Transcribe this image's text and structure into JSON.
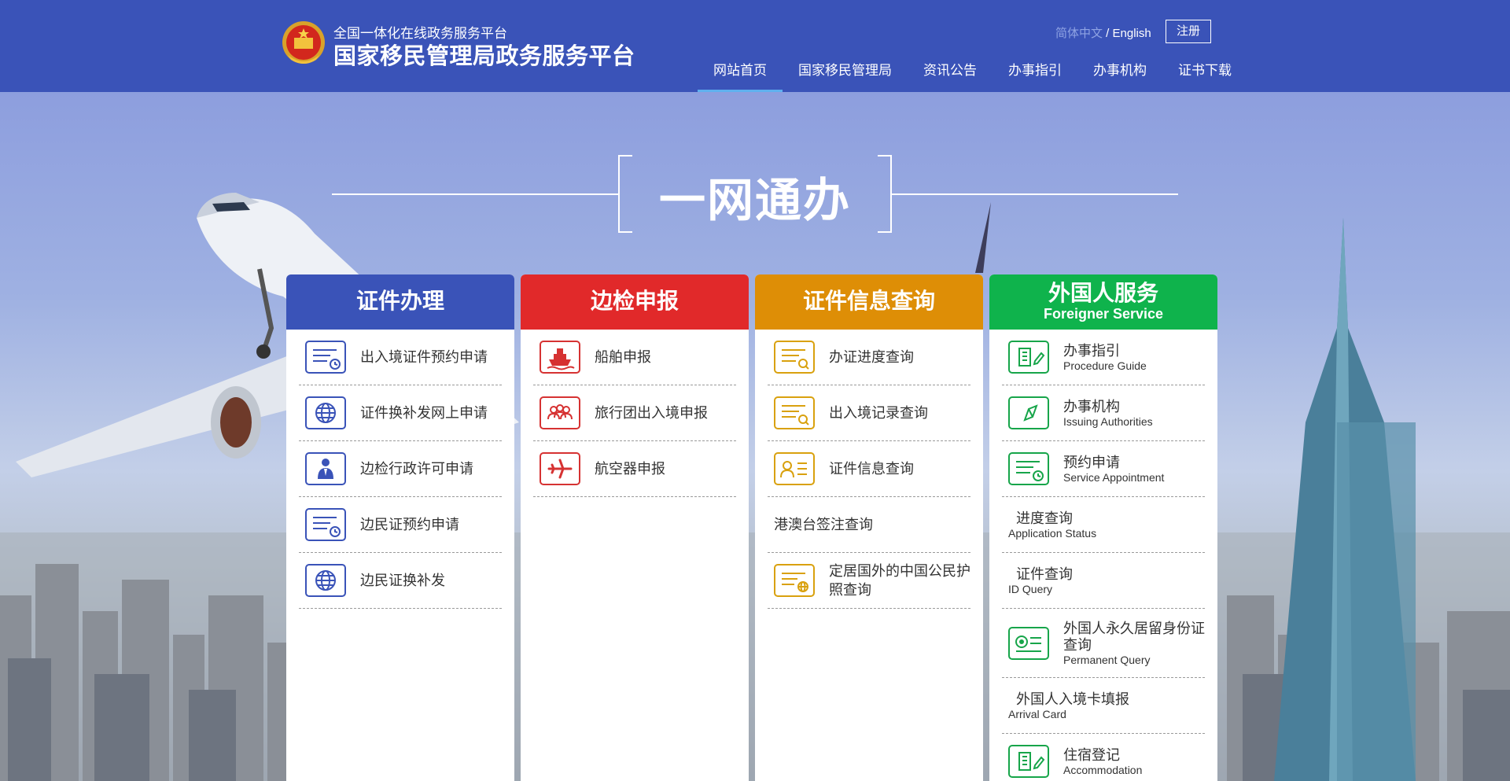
{
  "header": {
    "platform_sub": "全国一体化在线政务服务平台",
    "platform_main": "国家移民管理局政务服务平台",
    "lang_zh": "简体中文",
    "lang_sep": " / ",
    "lang_en": "English",
    "register": "注册",
    "nav": [
      "网站首页",
      "国家移民管理局",
      "资讯公告",
      "办事指引",
      "办事机构",
      "证书下载"
    ]
  },
  "slogan": "一网通办",
  "columns": {
    "permits": {
      "title": "证件办理",
      "color": "#3a53b8",
      "items": [
        "出入境证件预约申请",
        "证件换补发网上申请",
        "边检行政许可申请",
        "边民证预约申请",
        "边民证换补发"
      ]
    },
    "border": {
      "title": "边检申报",
      "color": "#e1292a",
      "items": [
        "船舶申报",
        "旅行团出入境申报",
        "航空器申报"
      ]
    },
    "query": {
      "title": "证件信息查询",
      "color": "#de8e06",
      "items": [
        "办证进度查询",
        "出入境记录查询",
        "证件信息查询",
        "港澳台签注查询",
        "定居国外的中国公民护照查询"
      ]
    },
    "foreigner": {
      "title": "外国人服务",
      "title_en": "Foreigner Service",
      "color": "#0fb34c",
      "items": [
        {
          "zh": "办事指引",
          "en": "Procedure Guide"
        },
        {
          "zh": "办事机构",
          "en": "Issuing Authorities"
        },
        {
          "zh": "预约申请",
          "en": "Service Appointment"
        },
        {
          "zh": "进度查询",
          "en": "Application Status"
        },
        {
          "zh": "证件查询",
          "en": "ID Query"
        },
        {
          "zh": "外国人永久居留身份证查询",
          "en": "Permanent Query"
        },
        {
          "zh": "外国人入境卡填报",
          "en": "Arrival Card"
        },
        {
          "zh": "住宿登记",
          "en": "Accommodation"
        }
      ]
    }
  }
}
